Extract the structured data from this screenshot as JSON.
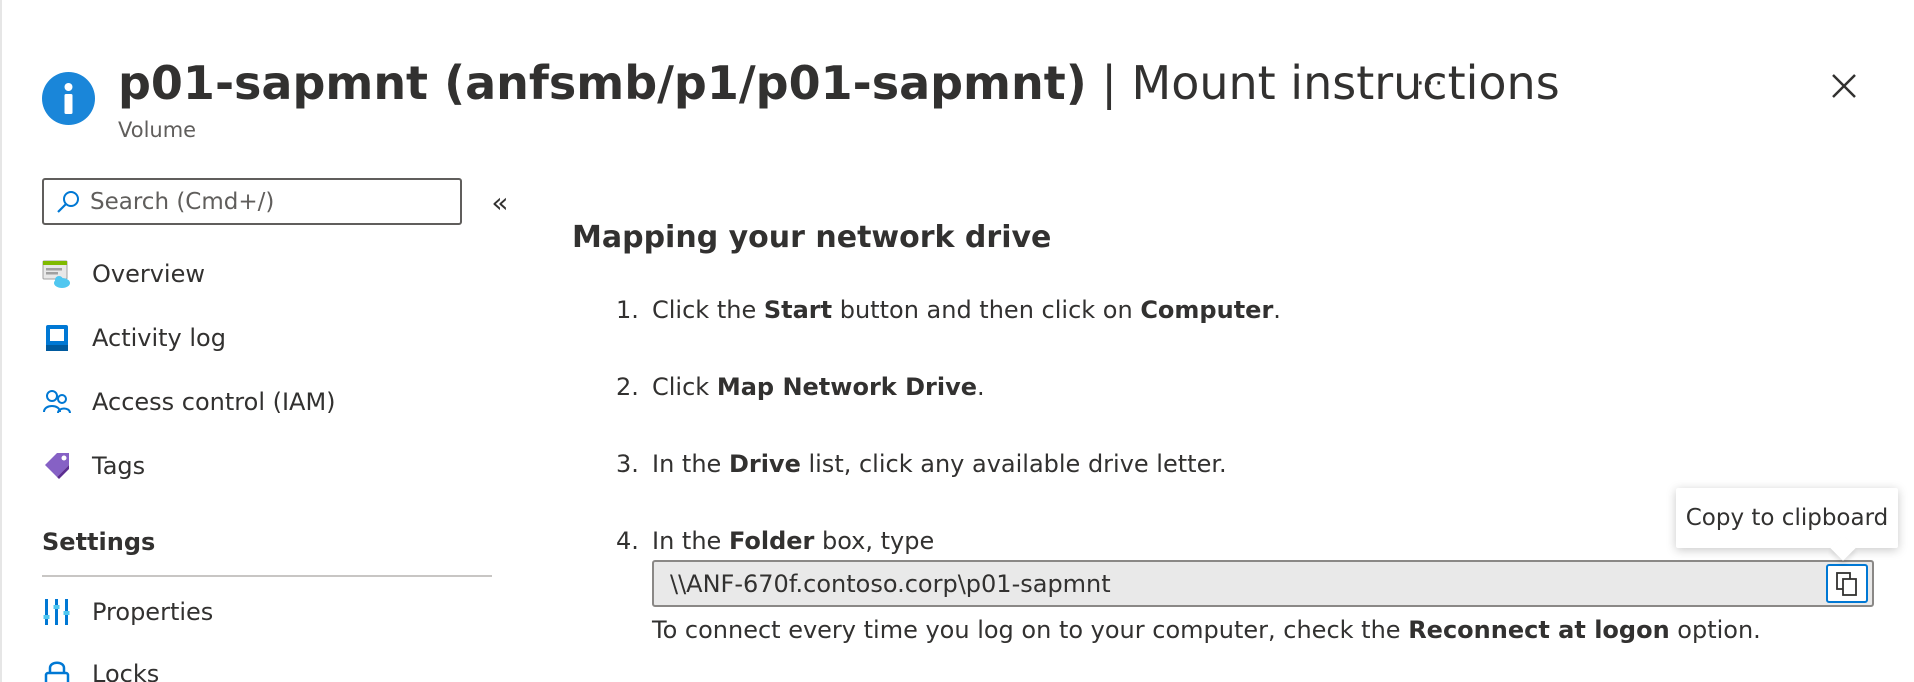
{
  "header": {
    "resource_name": "p01-sapmnt (anfsmb/p1/p01-sapmnt)",
    "separator": "|",
    "section_name": "Mount instructions",
    "subtitle": "Volume",
    "more_label": "···",
    "icon": "info-icon"
  },
  "sidebar": {
    "search_placeholder": "Search (Cmd+/)",
    "collapse_label": "«",
    "items": [
      {
        "label": "Overview",
        "icon": "overview-icon"
      },
      {
        "label": "Activity log",
        "icon": "activity-log-icon"
      },
      {
        "label": "Access control (IAM)",
        "icon": "access-control-icon"
      },
      {
        "label": "Tags",
        "icon": "tag-icon"
      }
    ],
    "settings_heading": "Settings",
    "settings_items": [
      {
        "label": "Properties",
        "icon": "properties-icon"
      },
      {
        "label": "Locks",
        "icon": "lock-icon"
      }
    ]
  },
  "main": {
    "heading": "Mapping your network drive",
    "steps": [
      {
        "num": "1.",
        "pre": "Click the ",
        "b1": "Start",
        "mid": " button and then click on ",
        "b2": "Computer",
        "post": "."
      },
      {
        "num": "2.",
        "pre": "Click ",
        "b1": "Map Network Drive",
        "post": "."
      },
      {
        "num": "3.",
        "pre": "In the ",
        "b1": "Drive",
        "post": " list, click any available drive letter."
      },
      {
        "num": "4.",
        "pre": "In the ",
        "b1": "Folder",
        "post": " box, type"
      }
    ],
    "path_value": "\\\\ANF-670f.contoso.corp\\p01-sapmnt",
    "reconnect_pre": "To connect every time you log on to your computer, check the ",
    "reconnect_bold": "Reconnect at logon",
    "reconnect_post": " option.",
    "tooltip": "Copy to clipboard"
  },
  "colors": {
    "accent": "#0078d4",
    "info_icon": "#1a86d9",
    "text": "#323130",
    "tags_icon": "#8661c5"
  }
}
